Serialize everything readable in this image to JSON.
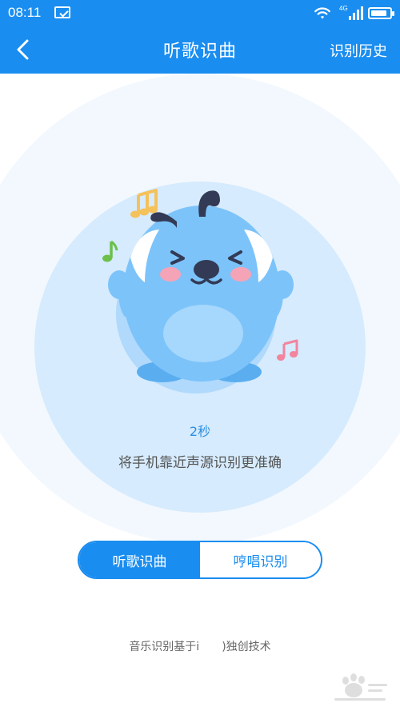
{
  "status_bar": {
    "time": "08:11",
    "network_label": "4G",
    "battery_level": 0.85
  },
  "header": {
    "title": "听歌识曲",
    "history_label": "识别历史",
    "back_icon": "chevron-left-icon"
  },
  "listening": {
    "timer": "2秒",
    "hint": "将手机靠近声源识别更准确"
  },
  "mode_toggle": {
    "tabs": [
      {
        "label": "听歌识曲",
        "active": true
      },
      {
        "label": "哼唱识别",
        "active": false
      }
    ]
  },
  "footer": {
    "tech_note": "音乐识别基于i　　)独创技术"
  },
  "colors": {
    "brand_blue": "#1a8df0",
    "mascot_blue": "#7cc3fa",
    "note_yellow": "#f5c15a",
    "note_green": "#6cc04a",
    "note_pink": "#f2849e"
  }
}
